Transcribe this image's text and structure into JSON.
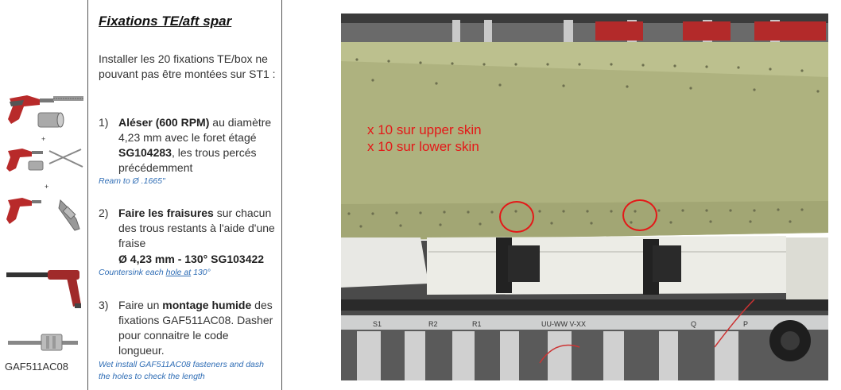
{
  "title": "Fixations TE/aft spar",
  "intro": "Installer les 20 fixations TE/box ne pouvant pas être montées sur ST1 :",
  "steps": [
    {
      "num": "1)",
      "bold": "Aléser (600 RPM)",
      "after": " au diamètre 4,23 mm avec le foret étagé ",
      "bold2": "SG104283",
      "after2": ", les trous percés précédemment",
      "english": "Ream to Ø .1665\""
    },
    {
      "num": "2)",
      "bold": "Faire les fraisures",
      "after": " sur chacun des trous restants à l'aide d'une fraise",
      "spec": "Ø 4,23 mm - 130° SG103422",
      "english_pre": "Countersink each ",
      "english_link": "hole  at",
      "english_post": " 130°"
    },
    {
      "num": "3)",
      "pre": "Faire un ",
      "bold": "montage humide",
      "after": " des fixations GAF511AC08. Dasher pour connaitre le code longueur.",
      "english": "Wet install GAF511AC08 fasteners and dash the holes to check the length"
    }
  ],
  "tools": {
    "plus": "+",
    "fastener_label": "GAF511AC08"
  },
  "photo": {
    "overlay_line1": "x 10 sur upper skin",
    "overlay_line2": "x 10 sur lower skin",
    "jig_labels": [
      "S1",
      "R2",
      "R1",
      "Q",
      "P"
    ],
    "jig_text": "UU-WW  V-XX"
  },
  "colors": {
    "accent_blue": "#2f6db5",
    "overlay_red": "#e41818",
    "panel_green": "#aeb27f"
  }
}
